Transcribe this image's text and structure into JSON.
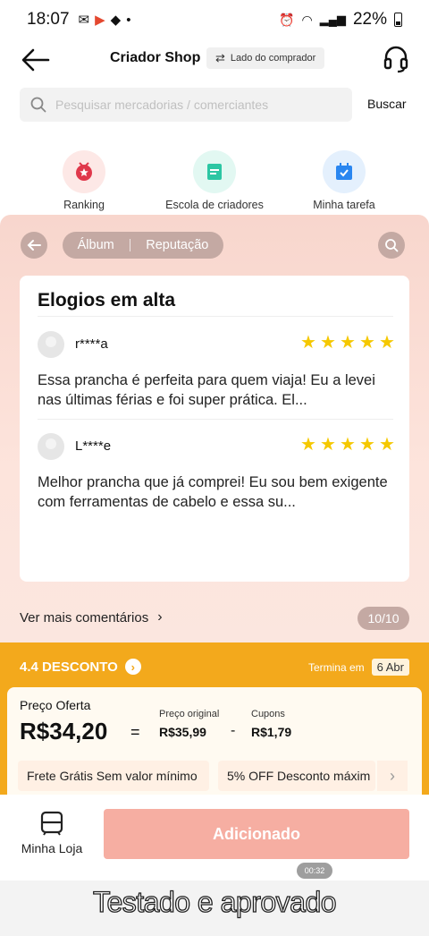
{
  "status_bar": {
    "time": "18:07",
    "battery": "22%"
  },
  "header": {
    "title": "Criador Shop",
    "mode_toggle": "Lado do comprador"
  },
  "search": {
    "placeholder": "Pesquisar mercadorias / comerciantes",
    "button": "Buscar"
  },
  "quick_menu": [
    {
      "label": "Ranking",
      "icon": "medal-icon",
      "color": "#e0384b",
      "bg": "#fde8e6"
    },
    {
      "label": "Escola de criadores",
      "icon": "book-icon",
      "color": "#2cc6a3",
      "bg": "#e2f8f2"
    },
    {
      "label": "Minha tarefa",
      "icon": "calendar-check-icon",
      "color": "#2a86f0",
      "bg": "#e4f0fd"
    }
  ],
  "review_panel": {
    "tabs": [
      "Álbum",
      "Reputação"
    ],
    "title": "Elogios em alta",
    "reviews": [
      {
        "user": "r****a",
        "stars": 5,
        "text": "Essa prancha é perfeita para quem viaja! Eu a levei nas últimas férias e foi super prática. El..."
      },
      {
        "user": "L****e",
        "stars": 5,
        "text": "Melhor prancha que já comprei! Eu sou bem exigente com ferramentas de cabelo e essa su..."
      }
    ],
    "see_more": "Ver mais comentários",
    "page_indicator": "10/10"
  },
  "discount": {
    "title": "4.4 DESCONTO",
    "ends_label": "Termina em",
    "ends_date": "6 Abr",
    "offer_label": "Preço Oferta",
    "offer_price": "R$34,20",
    "equals": "=",
    "original_label": "Preço original",
    "original_price": "R$35,99",
    "minus": "-",
    "coupon_label": "Cupons",
    "coupon_value": "R$1,79",
    "promos": [
      "Frete Grátis Sem valor mínimo",
      "5% OFF Desconto máxim"
    ]
  },
  "bottom_bar": {
    "shop_label": "Minha Loja",
    "added_button": "Adicionado",
    "timer": "00:32"
  },
  "caption": "Testado e aprovado"
}
